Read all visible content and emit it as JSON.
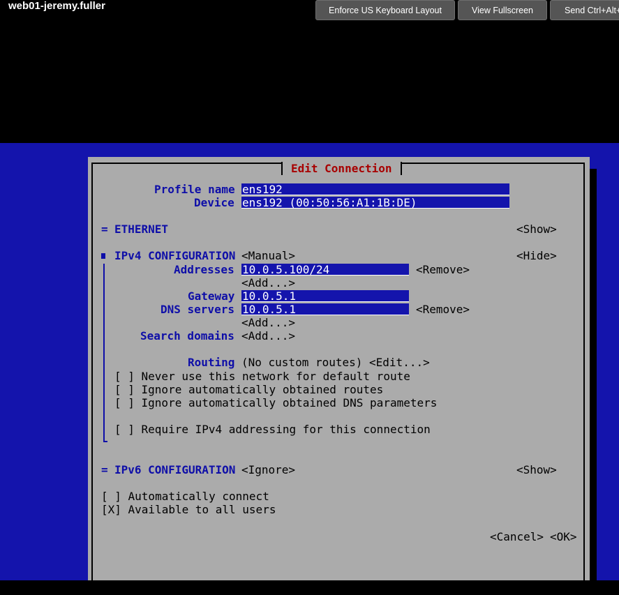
{
  "viewer": {
    "vm_name": "web01-jeremy.fuller",
    "buttons": [
      "Enforce US Keyboard Layout",
      "View Fullscreen",
      "Send Ctrl+Alt+"
    ]
  },
  "dialog": {
    "title": "Edit Connection",
    "profile_name_label": "Profile name",
    "profile_name_value": "ens192",
    "device_label": "Device",
    "device_value": "ens192 (00:50:56:A1:1B:DE)",
    "ethernet": {
      "marker": "=",
      "label": "ETHERNET",
      "toggle": "<Show>"
    },
    "ipv4": {
      "marker": "■",
      "label": "IPv4 CONFIGURATION",
      "mode": "<Manual>",
      "toggle": "<Hide>",
      "addresses_label": "Addresses",
      "address_value": "10.0.5.100/24",
      "remove_label": "<Remove>",
      "add_label": "<Add...>",
      "gateway_label": "Gateway",
      "gateway_value": "10.0.5.1",
      "dns_label": "DNS servers",
      "dns_value": "10.0.5.1",
      "dns_remove_label": "<Remove>",
      "dns_add_label": "<Add...>",
      "search_label": "Search domains",
      "search_add_label": "<Add...>",
      "routing_label": "Routing",
      "routing_value": "(No custom routes) <Edit...>",
      "checks": [
        "[ ] Never use this network for default route",
        "[ ] Ignore automatically obtained routes",
        "[ ] Ignore automatically obtained DNS parameters"
      ],
      "require_check": "[ ] Require IPv4 addressing for this connection"
    },
    "ipv6": {
      "marker": "=",
      "label": "IPv6 CONFIGURATION",
      "mode": "<Ignore>",
      "toggle": "<Show>"
    },
    "auto_connect": "[ ] Automatically connect",
    "all_users": "[X] Available to all users",
    "cancel": "<Cancel>",
    "ok": "<OK>"
  }
}
